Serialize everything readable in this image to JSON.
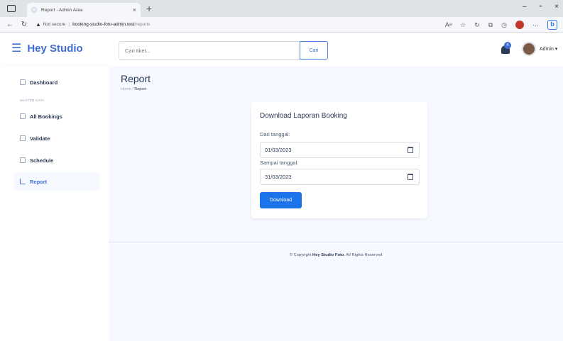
{
  "browser": {
    "tab_title": "Report - Admin Area",
    "url_warning": "Not secure",
    "url_host": "booking-studio-foto-admin.test",
    "url_path": "/reports"
  },
  "header": {
    "brand": "Hey Studio",
    "search_placeholder": "Cari tiket...",
    "search_button": "Cari",
    "notification_count": "4",
    "user_name": "Admin"
  },
  "sidebar": {
    "section_heading": "MASTER DATA",
    "items": [
      {
        "label": "Dashboard"
      },
      {
        "label": "All Bookings"
      },
      {
        "label": "Validate"
      },
      {
        "label": "Schedule"
      },
      {
        "label": "Report"
      }
    ]
  },
  "main": {
    "page_title": "Report",
    "breadcrumb_home": "Home",
    "breadcrumb_sep": "/",
    "breadcrumb_current": "Report",
    "card": {
      "title": "Download Laporan Booking",
      "from_label": "Dari tanggal:",
      "from_value": "01/03/2023",
      "to_label": "Sampai tanggal:",
      "to_value": "31/03/2023",
      "download_button": "Download"
    },
    "footer": {
      "prefix": "© Copyright",
      "brand": "Hey Studio Foto",
      "suffix": ". All Rights Reserved"
    }
  }
}
